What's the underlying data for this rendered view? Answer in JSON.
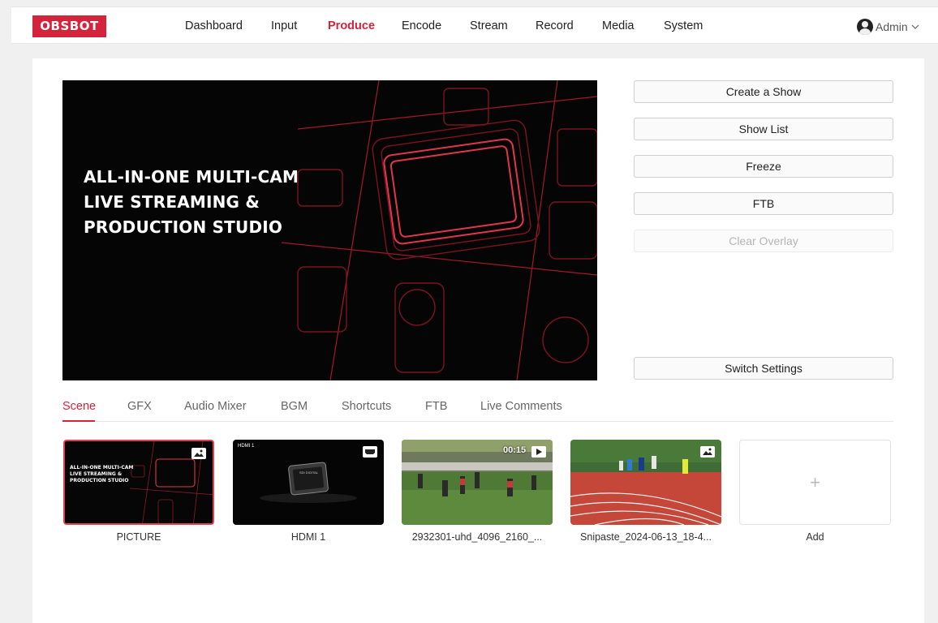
{
  "brand": {
    "logo": "OBSBOT",
    "accent": "#d4243c"
  },
  "nav": {
    "items": [
      "Dashboard",
      "Input",
      "Produce",
      "Encode",
      "Stream",
      "Record",
      "Media",
      "System"
    ],
    "active": "Produce"
  },
  "user": {
    "name": "Admin",
    "icon": "user-avatar-icon",
    "caret": "chevron-down-icon"
  },
  "preview": {
    "line1": "ALL-IN-ONE MULTI-CAM",
    "line2": "LIVE STREAMING &",
    "line3": "PRODUCTION STUDIO"
  },
  "controls": {
    "create_show": "Create a Show",
    "show_list": "Show List",
    "freeze": "Freeze",
    "ftb": "FTB",
    "clear_overlay": "Clear Overlay",
    "switch_settings": "Switch Settings"
  },
  "tabs": [
    "Scene",
    "GFX",
    "Audio Mixer",
    "BGM",
    "Shortcuts",
    "FTB",
    "Live Comments"
  ],
  "active_tab": "Scene",
  "scenes": [
    {
      "label": "PICTURE",
      "type": "image",
      "selected": true,
      "thumb_text": [
        "ALL-IN-ONE MULTI-CAM",
        "LIVE STREAMING &",
        "PRODUCTION STUDIO"
      ]
    },
    {
      "label": "HDMI 1",
      "type": "hdmi",
      "selected": false,
      "thumb_title": "HDMI 1",
      "device_text": "SDI DIGITAL"
    },
    {
      "label": "2932301-uhd_4096_2160_...",
      "type": "video",
      "selected": false,
      "duration": "00:15"
    },
    {
      "label": "Snipaste_2024-06-13_18-4...",
      "type": "image",
      "selected": false
    }
  ],
  "add": {
    "label": "Add",
    "symbol": "+"
  }
}
